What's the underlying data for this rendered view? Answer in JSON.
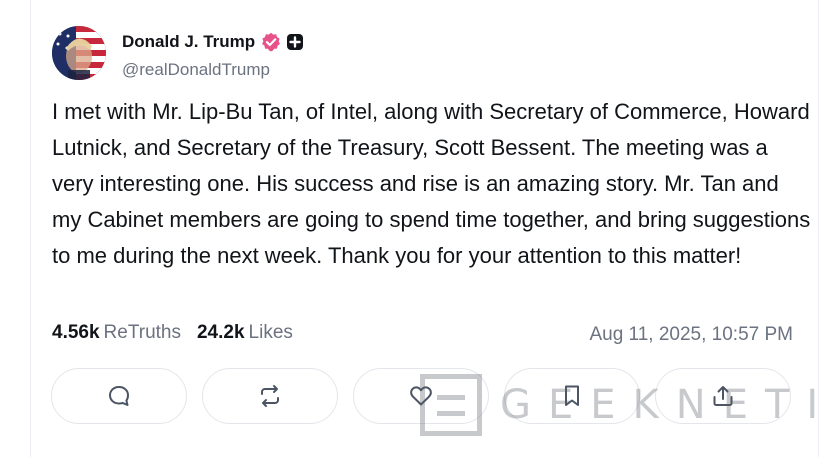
{
  "author": {
    "display_name": "Donald J. Trump",
    "handle": "@realDonaldTrump",
    "avatar_icon": "profile-avatar-flag",
    "verified_icon": "verified-check-badge-icon",
    "verified_color": "#e8528b",
    "plus_icon": "plus-badge-icon"
  },
  "post": {
    "text": "I met with Mr. Lip-Bu Tan, of Intel, along with Secretary of Commerce, Howard Lutnick, and Secretary of the Treasury, Scott Bessent. The meeting was a very interesting one. His success and rise is an amazing story. Mr. Tan and my Cabinet members are going to spend time together, and bring suggestions to me during the next week. Thank you for your attention to this matter!"
  },
  "stats": {
    "retruths_count": "4.56k",
    "retruths_label": "ReTruths",
    "likes_count": "24.2k",
    "likes_label": "Likes",
    "timestamp": "Aug 11, 2025, 10:57 PM"
  },
  "actions": [
    {
      "name": "reply",
      "icon": "reply-bubble-icon"
    },
    {
      "name": "retruth",
      "icon": "repost-arrows-icon"
    },
    {
      "name": "like",
      "icon": "heart-icon"
    },
    {
      "name": "bookmark",
      "icon": "bookmark-icon"
    },
    {
      "name": "share",
      "icon": "share-upload-icon"
    }
  ],
  "watermark": {
    "text": "GEEKNETIC"
  }
}
